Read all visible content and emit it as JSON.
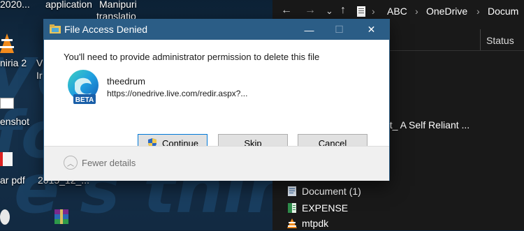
{
  "desktop": {
    "background_words": [
      "ves",
      "for",
      "e's think &"
    ],
    "labels": {
      "top1": "2020...",
      "top2": "application",
      "top3": "Manipuri",
      "top3b": "translatio",
      "icon1": "niria 2",
      "icon1b": "V",
      "icon1c": "Ir",
      "icon2": "enshot",
      "icon3a": "ar pdf",
      "icon3b": "2015_12_..."
    }
  },
  "explorer": {
    "nav": {
      "back": "←",
      "forward": "→",
      "dropdown": "⌄",
      "up": "↑"
    },
    "breadcrumb": [
      "ABC",
      "OneDrive",
      "Docum"
    ],
    "separator": "›",
    "columns": {
      "status": "Status"
    },
    "rows": [
      {
        "name": "nt_ A Self Reliant ..."
      },
      {
        "name": "Document (1)"
      },
      {
        "name": "EXPENSE"
      },
      {
        "name": "mtpdk"
      }
    ]
  },
  "dialog": {
    "title": "File Access Denied",
    "minimize": "—",
    "maximize": "☐",
    "close": "✕",
    "message": "You'll need to provide administrator permission to delete this file",
    "file_name": "theedrum",
    "file_url": "https://onedrive.live.com/redir.aspx?...",
    "badge": "BETA",
    "buttons": {
      "continue": "Continue",
      "skip": "Skip",
      "cancel": "Cancel"
    },
    "details_toggle": "Fewer details",
    "chevron": "︿"
  },
  "colors": {
    "titlebar": "#2b5d86",
    "dialog_bg": "#f0f0f0",
    "explorer_bg": "#191919",
    "badge": "#1a5fa8"
  }
}
